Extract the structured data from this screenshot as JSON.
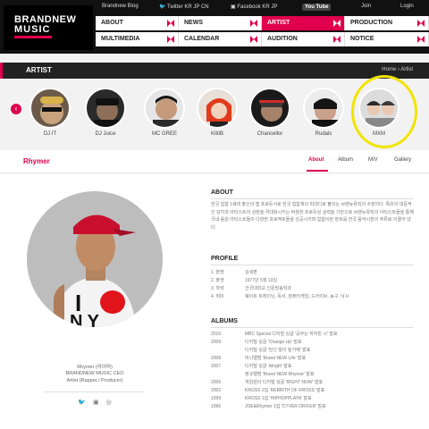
{
  "brand": {
    "line1": "BRANDNEW",
    "line2": "MUSIC"
  },
  "topbar": {
    "blog": "Brandnew Blog",
    "twitter": "Twitter  KR  JP  CN",
    "facebook": "Facebook  KR  JP",
    "youtube": "You Tube",
    "join": "Join",
    "login": "Login"
  },
  "nav": {
    "about": "ABOUT",
    "news": "NEWS",
    "artist": "ARTIST",
    "production": "PRODUCTION",
    "multimedia": "MULTIMEDIA",
    "calendar": "CALENDAR",
    "audition": "AUDITION",
    "notice": "NOTICE"
  },
  "section_bar": {
    "title": "ARTIST",
    "home": "Home",
    "crumb_sep": "›",
    "current": "Artist"
  },
  "artists": [
    {
      "name": "DJ IT"
    },
    {
      "name": "DJ Juice"
    },
    {
      "name": "MC GREE"
    },
    {
      "name": "KittiB"
    },
    {
      "name": "Chancellor"
    },
    {
      "name": "Rudals"
    },
    {
      "name": "MXM"
    }
  ],
  "profile_tabs": {
    "name": "Rhymer",
    "about": "About",
    "album": "Album",
    "mv": "M/V",
    "gallery": "Gallery"
  },
  "caption": {
    "name": "Rhymer (라이머)",
    "line2": "BRANDNEW MUSIC CEO",
    "line3": "Artist (Rapper / Producer)"
  },
  "about": {
    "title": "ABOUT",
    "text": "한국 힙합 1세대 출신의 랩 프로듀서로 한국 힙합계의 빅대디로 불리는 브랜뉴뮤직의 수장이다. 특유의 대중적인 감각과 아티스트의 성장을 극대화시키는 탁월한 프로듀싱 실력을 기반으로 브랜뉴뮤직의 아티스트들을 통해 국내 음원 아티스트들의 다양한 프로젝트들을 성공시키며 힙합이란 장르를 한국 음악시장의 주류로 이끌어 냈다."
  },
  "profile": {
    "title": "PROFILE",
    "rows": [
      {
        "k": "1. 본명",
        "v": "김세환"
      },
      {
        "k": "2. 출생",
        "v": "1977년 5월 13일"
      },
      {
        "k": "3. 학력",
        "v": "건국대학교 신문방송학과"
      },
      {
        "k": "4. 취미",
        "v": "웨이트 트레이닝, 독서, 컴퓨터게임, 드라이브, 농구, 낚시"
      }
    ]
  },
  "albums": {
    "title": "ALBUMS",
    "rows": [
      {
        "y": "2010",
        "t": "MBC Special 디지털 싱글 '공부는 하지만 시' 발표"
      },
      {
        "y": "2009",
        "t": "디지털 싱글 'Change Up' 발표"
      },
      {
        "y": "",
        "t": "디지털 싱글 '당신 말이 될거예' 발표"
      },
      {
        "y": "2008",
        "t": "미니앨범 'Brand NEW Life' 발표"
      },
      {
        "y": "2007",
        "t": "디지털 싱글 'Alright' 발표"
      },
      {
        "y": "",
        "t": "정규앨범 'Brand NEW Rhymer' 발표"
      },
      {
        "y": "2006",
        "t": "게임원더 디지털 싱글 'RIGHT NOW' 발표"
      },
      {
        "y": "2002",
        "t": "KROSS 2집 'REBIRTH OF KROSS' 발표"
      },
      {
        "y": "1999",
        "t": "KROSS 1집 'HIPHOPPLAYA' 발표"
      },
      {
        "y": "1996",
        "t": "JOE&Rhymer 1집 'CYVER DRIVER' 발표"
      }
    ]
  },
  "colors": {
    "accent": "#e0004d",
    "highlight": "#f1e400",
    "dark": "#111111"
  }
}
